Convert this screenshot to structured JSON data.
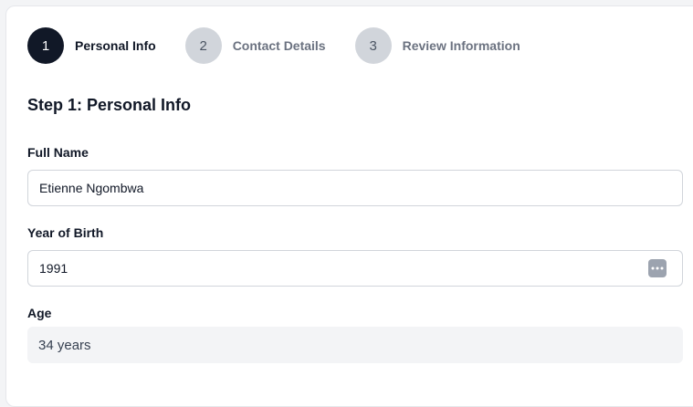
{
  "stepper": {
    "steps": [
      {
        "number": "1",
        "label": "Personal Info",
        "state": "active"
      },
      {
        "number": "2",
        "label": "Contact Details",
        "state": "inactive"
      },
      {
        "number": "3",
        "label": "Review Information",
        "state": "inactive"
      }
    ]
  },
  "form": {
    "title": "Step 1: Personal Info",
    "full_name": {
      "label": "Full Name",
      "value": "Etienne Ngombwa"
    },
    "year_of_birth": {
      "label": "Year of Birth",
      "value": "1991",
      "picker_icon": "more-dots-icon"
    },
    "age": {
      "label": "Age",
      "value": "34 years"
    }
  },
  "colors": {
    "active_step": "#111827",
    "inactive_step": "#d1d5db",
    "readonly_bg": "#f3f4f6"
  }
}
